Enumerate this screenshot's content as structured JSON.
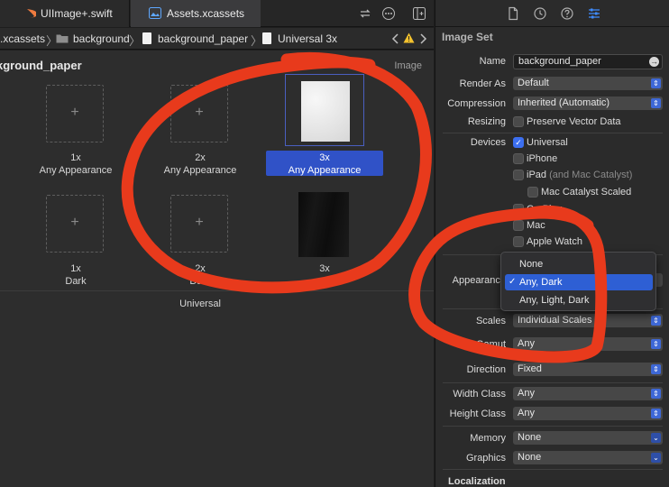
{
  "tabs": [
    {
      "label": "UIImage+.swift",
      "icon": "swift-icon"
    },
    {
      "label": "Assets.xcassets",
      "icon": "assets-icon"
    }
  ],
  "jumpbar": {
    "items": [
      ".xcassets",
      "background",
      "background_paper",
      "Universal 3x"
    ],
    "separator": "〉"
  },
  "canvas": {
    "title": "kground_paper",
    "image_label": "Image",
    "slots": [
      {
        "scale": "1x",
        "appearance": "Any Appearance",
        "filled": false
      },
      {
        "scale": "2x",
        "appearance": "Any Appearance",
        "filled": false
      },
      {
        "scale": "3x",
        "appearance": "Any Appearance",
        "filled": true,
        "selected": true
      },
      {
        "scale": "1x",
        "appearance": "Dark",
        "filled": false
      },
      {
        "scale": "2x",
        "appearance": "Dark",
        "filled": false
      },
      {
        "scale": "3x",
        "appearance": "",
        "filled": true
      }
    ],
    "group_label": "Universal",
    "plus": "+"
  },
  "inspector": {
    "section_title": "Image Set",
    "name_label": "Name",
    "name_value": "background_paper",
    "render_as_label": "Render As",
    "render_as_value": "Default",
    "compression_label": "Compression",
    "compression_value": "Inherited (Automatic)",
    "resizing_label": "Resizing",
    "resizing_option": "Preserve Vector Data",
    "devices_label": "Devices",
    "devices": [
      {
        "label": "Universal",
        "checked": true
      },
      {
        "label": "iPhone",
        "checked": false
      },
      {
        "label": "iPad",
        "extra": "(and Mac Catalyst)",
        "checked": false
      },
      {
        "label": "Mac Catalyst Scaled",
        "checked": false
      },
      {
        "label": "CarPlay",
        "checked": false
      },
      {
        "label": "Mac",
        "checked": false
      },
      {
        "label": "Apple Watch",
        "checked": false
      }
    ],
    "appearance_label": "Appearance",
    "scales_label": "Scales",
    "scales_value": "Individual Scales",
    "gamut_label": "Gamut",
    "gamut_value": "Any",
    "direction_label": "Direction",
    "direction_value": "Fixed",
    "width_class_label": "Width Class",
    "width_class_value": "Any",
    "height_class_label": "Height Class",
    "height_class_value": "Any",
    "memory_label": "Memory",
    "memory_value": "None",
    "graphics_label": "Graphics",
    "graphics_value": "None",
    "localization_label": "Localization"
  },
  "appearance_menu": {
    "items": [
      "None",
      "Any, Dark",
      "Any, Light, Dark"
    ],
    "selected_index": 1,
    "checkmark": "✓"
  },
  "colors": {
    "accent": "#3052c7",
    "annotation": "#e83a1c"
  }
}
